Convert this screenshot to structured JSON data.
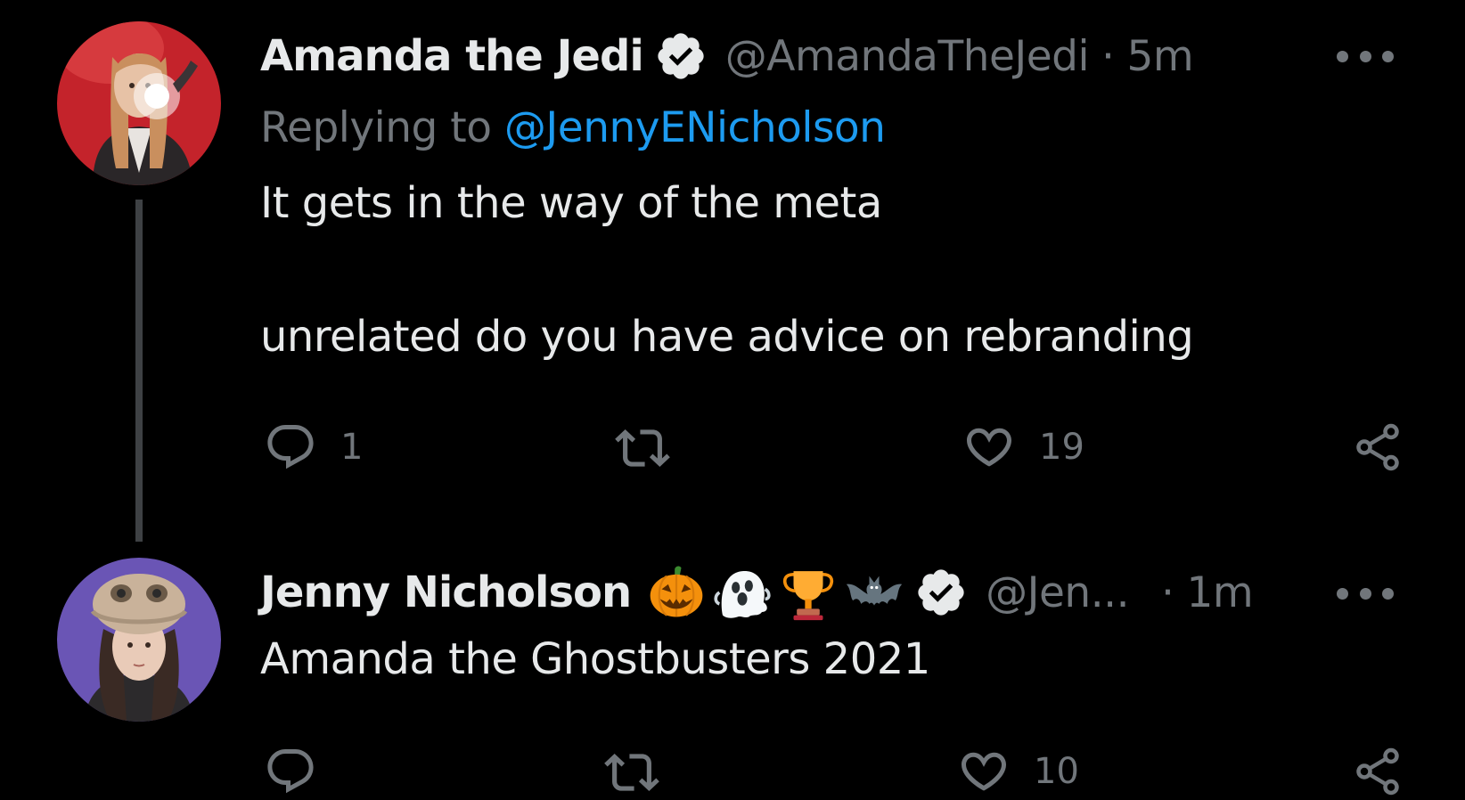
{
  "tweets": [
    {
      "author": {
        "display_name": "Amanda the Jedi",
        "handle": "@AmandaTheJedi",
        "verified": true
      },
      "separator": "·",
      "time": "5m",
      "reply_prefix": "Replying to ",
      "reply_to": "@JennyENicholson",
      "text_lines": [
        "It gets in the way of the meta",
        "unrelated do you have advice on rebranding"
      ],
      "actions": {
        "reply_count": "1",
        "retweet_count": "",
        "like_count": "19"
      }
    },
    {
      "author": {
        "display_name": "Jenny Nicholson",
        "handle": "@Jen...",
        "verified": true,
        "name_emojis": [
          "jack-o-lantern",
          "ghost",
          "trophy",
          "bat"
        ]
      },
      "separator": "·",
      "time": "1m",
      "text_lines": [
        "Amanda the Ghostbusters 2021"
      ],
      "actions": {
        "reply_count": "",
        "retweet_count": "",
        "like_count": "10"
      }
    }
  ],
  "colors": {
    "background": "#000000",
    "text_primary": "#e7e9ea",
    "text_secondary": "#71767b",
    "link": "#1d9bf0",
    "thread_line": "#3e4144"
  }
}
